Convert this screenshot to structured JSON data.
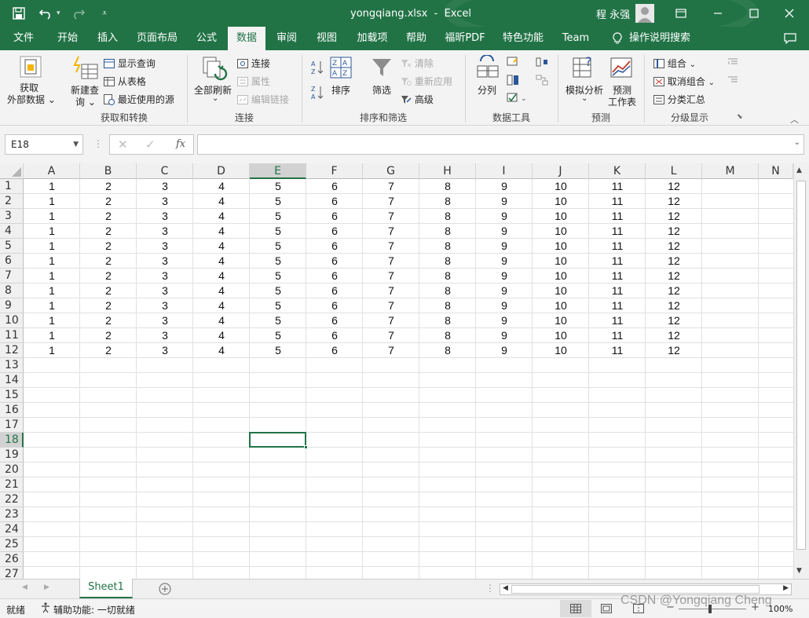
{
  "title": {
    "filename": "yongqiang.xlsx",
    "sep": "-",
    "app": "Excel",
    "user": "程 永强"
  },
  "tabs": [
    "文件",
    "开始",
    "插入",
    "页面布局",
    "公式",
    "数据",
    "审阅",
    "视图",
    "加载项",
    "帮助",
    "福昕PDF",
    "特色功能",
    "Team",
    "操作说明搜索"
  ],
  "active_tab": "数据",
  "ribbon": {
    "get_external": [
      "获取",
      "外部数据"
    ],
    "new_query": [
      "新建查",
      "询"
    ],
    "show_query": "显示查询",
    "from_table": "从表格",
    "recent_sources": "最近使用的源",
    "group1": "获取和转换",
    "refresh_all": "全部刷新",
    "connections": "连接",
    "properties": "属性",
    "edit_links": "编辑链接",
    "group2": "连接",
    "sort": "排序",
    "filter": "筛选",
    "clear": "清除",
    "reapply": "重新应用",
    "advanced": "高级",
    "group3": "排序和筛选",
    "text_to_cols": "分列",
    "group4": "数据工具",
    "what_if": "模拟分析",
    "forecast": [
      "预测",
      "工作表"
    ],
    "group5": "预测",
    "group_btn": "组合",
    "ungroup": "取消组合",
    "subtotal": "分类汇总",
    "group6": "分级显示"
  },
  "name_box": "E18",
  "columns": [
    "A",
    "B",
    "C",
    "D",
    "E",
    "F",
    "G",
    "H",
    "I",
    "J",
    "K",
    "L",
    "M",
    "N"
  ],
  "data_values": [
    "1",
    "2",
    "3",
    "4",
    "5",
    "6",
    "7",
    "8",
    "9",
    "10",
    "11",
    "12"
  ],
  "data_rows": 12,
  "visible_rows": 27,
  "selected_cell": {
    "col": "E",
    "row": 18
  },
  "sheet_tab": "Sheet1",
  "status": {
    "ready": "就绪",
    "accessibility": "辅助功能: 一切就绪",
    "zoom": "100%",
    "watermark": "CSDN @Yongqiang Cheng"
  },
  "colors": {
    "accent": "#217346",
    "grid": "#e1e1e1"
  }
}
